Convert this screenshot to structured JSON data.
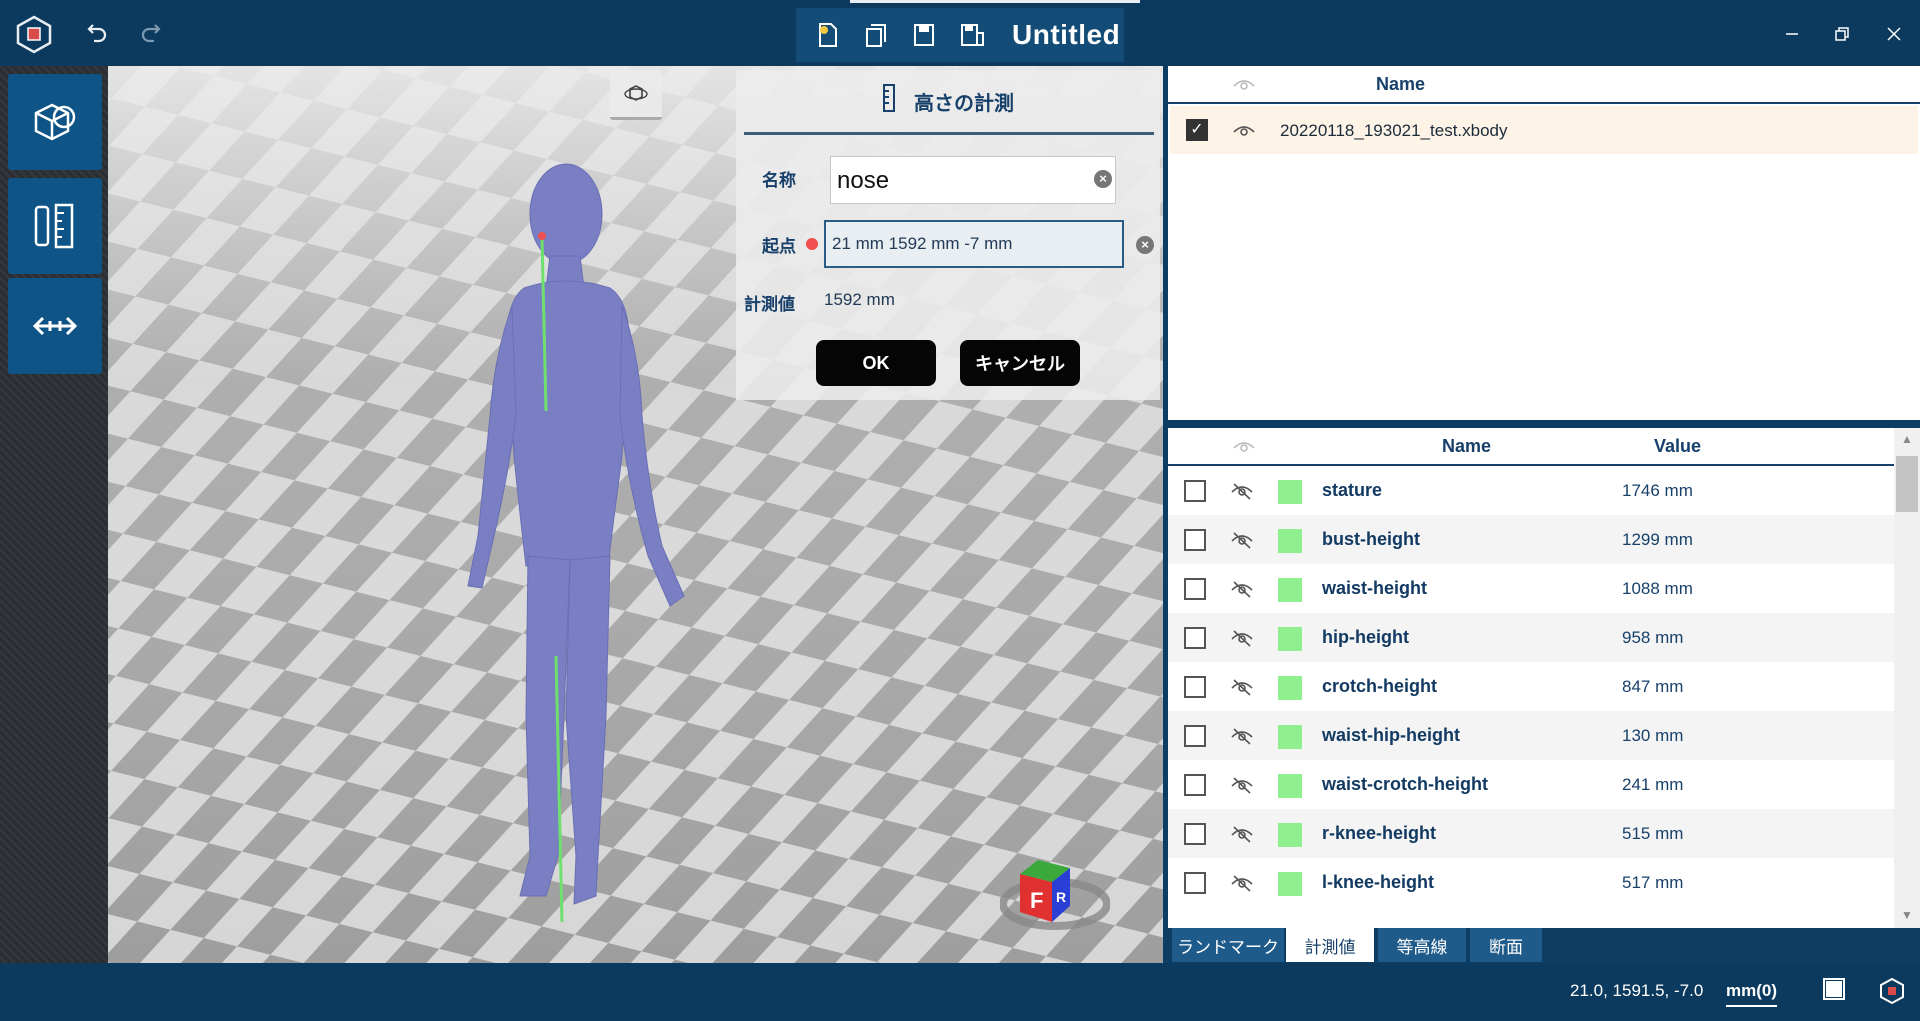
{
  "window": {
    "title": "Untitled"
  },
  "dialog": {
    "title": "高さの計測",
    "name_label": "名称",
    "name_value": "nose",
    "start_label": "起点",
    "start_value": "21 mm   1592 mm   -7 mm",
    "measured_label": "計測値",
    "measured_value": "1592 mm",
    "ok_label": "OK",
    "cancel_label": "キャンセル"
  },
  "files_panel": {
    "name_header": "Name",
    "rows": [
      {
        "name": "20220118_193021_test.xbody",
        "checked": true
      }
    ]
  },
  "measurements_panel": {
    "name_header": "Name",
    "value_header": "Value",
    "swatch_color": "#90f090",
    "rows": [
      {
        "name": "stature",
        "value": "1746 mm"
      },
      {
        "name": "bust-height",
        "value": "1299 mm"
      },
      {
        "name": "waist-height",
        "value": "1088 mm"
      },
      {
        "name": "hip-height",
        "value": "958 mm"
      },
      {
        "name": "crotch-height",
        "value": "847 mm"
      },
      {
        "name": "waist-hip-height",
        "value": "130 mm"
      },
      {
        "name": "waist-crotch-height",
        "value": "241 mm"
      },
      {
        "name": "r-knee-height",
        "value": "515 mm"
      },
      {
        "name": "l-knee-height",
        "value": "517 mm"
      }
    ]
  },
  "tabs": [
    {
      "label": "ランドマーク",
      "active": false
    },
    {
      "label": "計測値",
      "active": true
    },
    {
      "label": "等高線",
      "active": false
    },
    {
      "label": "断面",
      "active": false
    }
  ],
  "status": {
    "coords": "21.0, 1591.5, -7.0",
    "units": "mm(0)"
  },
  "view_cube": {
    "front_letter": "F",
    "right_letter": "R"
  },
  "colors": {
    "accent": "#0d3d63",
    "toolbar_button": "#0f5486",
    "body_model": "#7a7fc4",
    "measure_line": "#6ee06e"
  }
}
